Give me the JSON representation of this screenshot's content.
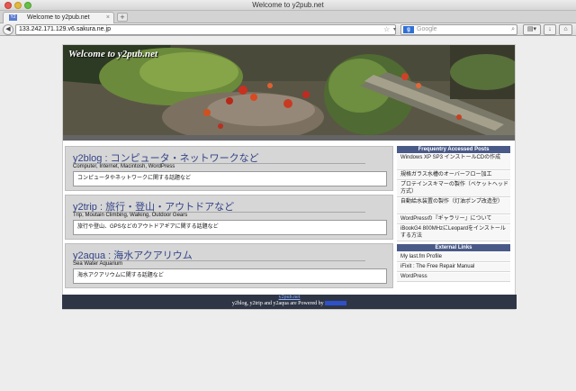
{
  "browser": {
    "window_title": "Welcome to y2pub.net",
    "tab_title": "Welcome to y2pub.net",
    "tab_favicon": "Y2",
    "new_tab_label": "+",
    "url": "133.242.171.129.v6.sakura.ne.jp",
    "search_placeholder": "Google",
    "search_engine_letter": "g"
  },
  "banner": {
    "title": "Welcome to y2pub.net"
  },
  "entries": [
    {
      "title": "y2blog : コンピュータ・ネットワークなど",
      "tags": "Computer, Internet, Macintosh, WordPress",
      "description": "コンピュータやネットワークに関する話題など"
    },
    {
      "title": "y2trip : 旅行・登山・アウトドアなど",
      "tags": "Trip, Moutain Climbing, Walking, Outdoor Gears",
      "description": "旅行や登山、GPSなどのアウトドアギアに関する話題など"
    },
    {
      "title": "y2aqua : 海水アクアリウム",
      "tags": "Sea Water Aquarium",
      "description": "海水アクアリウムに関する話題など"
    }
  ],
  "sidebar": {
    "frequent_heading": "Frequentry Accessed Posts",
    "frequent_items": [
      "Windows XP SP3 インストールCDの作成",
      "規格ガラス水槽のオーバーフロー加工",
      "プロテインスキマーの製作（ベケットヘッド方式）",
      "自動給水装置の製作（灯油ポンプ改造型）",
      "WordPressの『ギャラリー』について",
      "iBookG4 800MHzにLeopardをインストールする方法"
    ],
    "external_heading": "External Links",
    "external_items": [
      "My last.fm Profile",
      "iFixit : The Free Repair Manual",
      "WordPress"
    ]
  },
  "footer": {
    "site_link": "y2pub.net",
    "credit": "y2blog, y2trip and y2aqua are Powered by"
  },
  "colors": {
    "entry_title": "#334488",
    "sidebar_heading": "#4a5a88",
    "footer_bg": "#2e3646"
  }
}
